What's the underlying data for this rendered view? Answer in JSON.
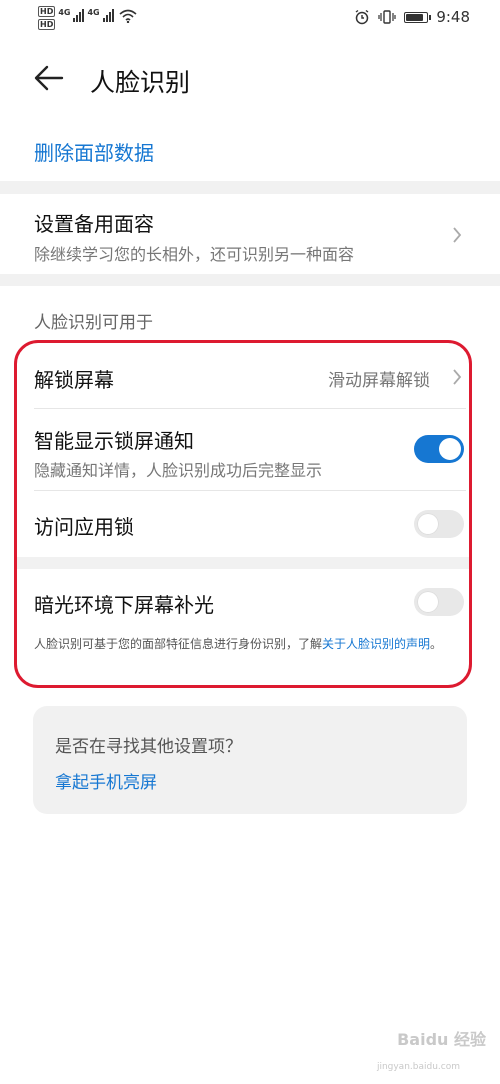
{
  "status_bar": {
    "sim1": "HD",
    "sim2": "HD",
    "net1": "4G",
    "net2": "4G",
    "battery_level": 0.9,
    "time": "9:48"
  },
  "header": {
    "title": "人脸识别"
  },
  "actions": {
    "delete_face_data": "删除面部数据"
  },
  "backup": {
    "title": "设置备用面容",
    "subtitle": "除继续学习您的长相外，还可识别另一种面容"
  },
  "usage": {
    "section_label": "人脸识别可用于",
    "unlock": {
      "title": "解锁屏幕",
      "value": "滑动屏幕解锁"
    },
    "smart_notify": {
      "title": "智能显示锁屏通知",
      "subtitle": "隐藏通知详情，人脸识别成功后完整显示",
      "enabled": true
    },
    "app_lock": {
      "title": "访问应用锁",
      "enabled": false
    },
    "fill_light": {
      "title": "暗光环境下屏幕补光",
      "enabled": false
    },
    "footnote": {
      "text": "人脸识别可基于您的面部特征信息进行身份识别，了解",
      "link": "关于人脸识别的声明",
      "end": "。"
    }
  },
  "suggestion": {
    "title": "是否在寻找其他设置项？",
    "link": "拿起手机亮屏"
  },
  "watermark": {
    "brand": "Baidu 经验",
    "url": "jingyan.baidu.com"
  },
  "colors": {
    "accent": "#1677d2",
    "highlight": "#dd1a30"
  }
}
